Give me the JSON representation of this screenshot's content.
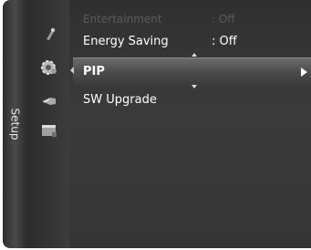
{
  "sidebar": {
    "label": "Setup"
  },
  "menu_icons": [
    {
      "name": "satellite-dish-icon"
    },
    {
      "name": "gear-icon"
    },
    {
      "name": "input-plug-icon"
    },
    {
      "name": "application-window-icon"
    }
  ],
  "menu": {
    "items": [
      {
        "label": "Entertainment",
        "value": ": Off"
      },
      {
        "label": "Energy Saving",
        "value": ": Off"
      },
      {
        "label": "PIP",
        "value": ""
      },
      {
        "label": "SW Upgrade",
        "value": ""
      }
    ]
  },
  "colors": {
    "panel": "#353535",
    "highlight": "#5c5c5c",
    "text": "#ffffff",
    "dim_text": "#5a5a5a"
  }
}
